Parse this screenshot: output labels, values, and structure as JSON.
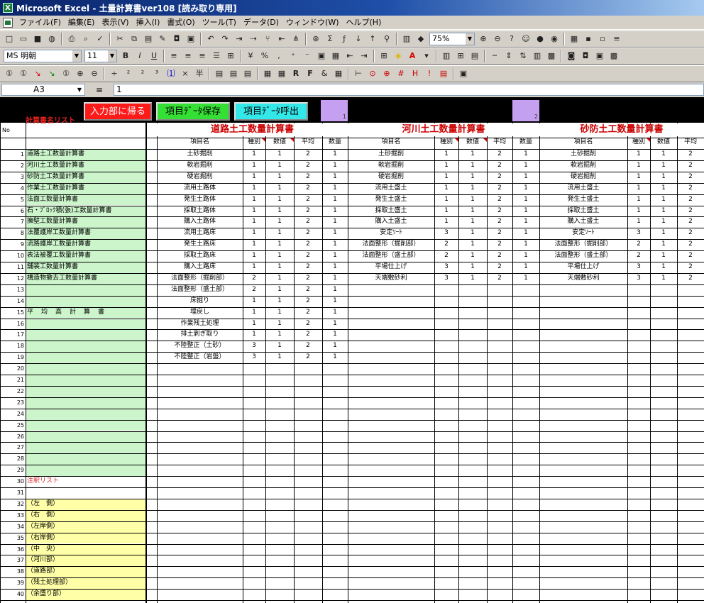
{
  "window": {
    "title": "Microsoft Excel - 土量計算書ver108 [読み取り専用]"
  },
  "menu": [
    "ファイル(F)",
    "編集(E)",
    "表示(V)",
    "挿入(I)",
    "書式(O)",
    "ツール(T)",
    "データ(D)",
    "ウィンドウ(W)",
    "ヘルプ(H)"
  ],
  "toolbar1": {
    "zoom": "75%"
  },
  "toolbar2": {
    "font": "MS 明朝",
    "size": "11"
  },
  "formula": {
    "cell": "A3",
    "value": "1"
  },
  "sheet": {
    "buttons": {
      "back": "入力部に帰る",
      "save": "項目ﾃﾞｰﾀ保存",
      "load": "項目ﾃﾞｰﾀ呼出"
    },
    "list_label": "計算書名リスト",
    "page_marks": [
      "1",
      "2"
    ],
    "no_header": "No",
    "sections": [
      "道路土工数量計算書",
      "河川土工数量計算書",
      "砂防土工数量計算書"
    ],
    "col_headers": {
      "item": "項目名",
      "type": "種別",
      "value": "数値",
      "avg": "平均",
      "qty": "数量"
    },
    "rows": [
      {
        "n": "1",
        "s": "道路土工数量計算書"
      },
      {
        "n": "2",
        "s": "河川土工数量計算書"
      },
      {
        "n": "3",
        "s": "砂防土工数量計算書"
      },
      {
        "n": "4",
        "s": "作業土工数量計算書"
      },
      {
        "n": "5",
        "s": "法面工数量計算書"
      },
      {
        "n": "6",
        "s": "石・ﾌﾞﾛｯｸ積(張)工数量計算書"
      },
      {
        "n": "7",
        "s": "擁壁工数量計算書"
      },
      {
        "n": "8",
        "s": "法覆護岸工数量計算書"
      },
      {
        "n": "9",
        "s": "流路護岸工数量計算書"
      },
      {
        "n": "10",
        "s": "表法被覆工数量計算書"
      },
      {
        "n": "11",
        "s": "舗装工数量計算書"
      },
      {
        "n": "12",
        "s": "構造物撤去工数量計算書"
      },
      {
        "n": "13",
        "s": ""
      },
      {
        "n": "14",
        "s": ""
      },
      {
        "n": "15",
        "s": "平　均　高　計　算　書"
      },
      {
        "n": "16",
        "s": ""
      },
      {
        "n": "17",
        "s": ""
      },
      {
        "n": "18",
        "s": ""
      },
      {
        "n": "19",
        "s": ""
      },
      {
        "n": "20",
        "s": ""
      },
      {
        "n": "21",
        "s": ""
      },
      {
        "n": "22",
        "s": ""
      },
      {
        "n": "23",
        "s": ""
      },
      {
        "n": "24",
        "s": ""
      },
      {
        "n": "25",
        "s": ""
      },
      {
        "n": "26",
        "s": ""
      },
      {
        "n": "27",
        "s": ""
      },
      {
        "n": "28",
        "s": ""
      },
      {
        "n": "29",
        "s": ""
      },
      {
        "n": "30",
        "s": "注釈リスト"
      },
      {
        "n": "31",
        "s": ""
      },
      {
        "n": "32",
        "s": "（左　側）"
      },
      {
        "n": "33",
        "s": "（右　側）"
      },
      {
        "n": "34",
        "s": "（左岸側）"
      },
      {
        "n": "35",
        "s": "（右岸側）"
      },
      {
        "n": "36",
        "s": "（中　央）"
      },
      {
        "n": "37",
        "s": "（河川部）"
      },
      {
        "n": "38",
        "s": "（道路部）"
      },
      {
        "n": "39",
        "s": "（残土処理部）"
      },
      {
        "n": "40",
        "s": "（余盛り部）"
      }
    ],
    "road": [
      [
        "土砂掘削",
        "1",
        "1",
        "2",
        "1"
      ],
      [
        "軟岩掘削",
        "1",
        "1",
        "2",
        "1"
      ],
      [
        "硬岩掘削",
        "1",
        "1",
        "2",
        "1"
      ],
      [
        "流用土路体",
        "1",
        "1",
        "2",
        "1"
      ],
      [
        "発生土路体",
        "1",
        "1",
        "2",
        "1"
      ],
      [
        "採取土路体",
        "1",
        "1",
        "2",
        "1"
      ],
      [
        "購入土路体",
        "1",
        "1",
        "2",
        "1"
      ],
      [
        "流用土路床",
        "1",
        "1",
        "2",
        "1"
      ],
      [
        "発生土路床",
        "1",
        "1",
        "2",
        "1"
      ],
      [
        "採取土路床",
        "1",
        "1",
        "2",
        "1"
      ],
      [
        "購入土路床",
        "1",
        "1",
        "2",
        "1"
      ],
      [
        "法面整形（掘削部）",
        "2",
        "1",
        "2",
        "1"
      ],
      [
        "法面整形（盛土部）",
        "2",
        "1",
        "2",
        "1"
      ],
      [
        "床掘り",
        "1",
        "1",
        "2",
        "1"
      ],
      [
        "埋戻し",
        "1",
        "1",
        "2",
        "1"
      ],
      [
        "作業残土処理",
        "1",
        "1",
        "2",
        "1"
      ],
      [
        "排土剥ぎ取り",
        "1",
        "1",
        "2",
        "1"
      ],
      [
        "不陸整正（土砂）",
        "3",
        "1",
        "2",
        "1"
      ],
      [
        "不陸整正（岩盤）",
        "3",
        "1",
        "2",
        "1"
      ]
    ],
    "river": [
      [
        "土砂掘削",
        "1",
        "1",
        "2",
        "1"
      ],
      [
        "軟岩掘削",
        "1",
        "1",
        "2",
        "1"
      ],
      [
        "硬岩掘削",
        "1",
        "1",
        "2",
        "1"
      ],
      [
        "流用土盛土",
        "1",
        "1",
        "2",
        "1"
      ],
      [
        "発生土盛土",
        "1",
        "1",
        "2",
        "1"
      ],
      [
        "採取土盛土",
        "1",
        "1",
        "2",
        "1"
      ],
      [
        "購入土盛土",
        "1",
        "1",
        "2",
        "1"
      ],
      [
        "安定ｿｰﾄ",
        "3",
        "1",
        "2",
        "1"
      ],
      [
        "法面整形（掘削部）",
        "2",
        "1",
        "2",
        "1"
      ],
      [
        "法面整形（盛土部）",
        "2",
        "1",
        "2",
        "1"
      ],
      [
        "平場仕上げ",
        "3",
        "1",
        "2",
        "1"
      ],
      [
        "天端敷砂利",
        "3",
        "1",
        "2",
        "1"
      ]
    ],
    "sabo": [
      [
        "土砂掘削",
        "1",
        "1",
        "2"
      ],
      [
        "軟岩掘削",
        "1",
        "1",
        "2"
      ],
      [
        "硬岩掘削",
        "1",
        "1",
        "2"
      ],
      [
        "流用土盛土",
        "1",
        "1",
        "2"
      ],
      [
        "発生土盛土",
        "1",
        "1",
        "2"
      ],
      [
        "採取土盛土",
        "1",
        "1",
        "2"
      ],
      [
        "購入土盛土",
        "1",
        "1",
        "2"
      ],
      [
        "安定ｿｰﾄ",
        "3",
        "1",
        "2"
      ],
      [
        "法面整形（掘削部）",
        "2",
        "1",
        "2"
      ],
      [
        "法面整形（盛土部）",
        "2",
        "1",
        "2"
      ],
      [
        "平場仕上げ",
        "3",
        "1",
        "2"
      ],
      [
        "天端敷砂利",
        "3",
        "1",
        "2"
      ]
    ]
  }
}
